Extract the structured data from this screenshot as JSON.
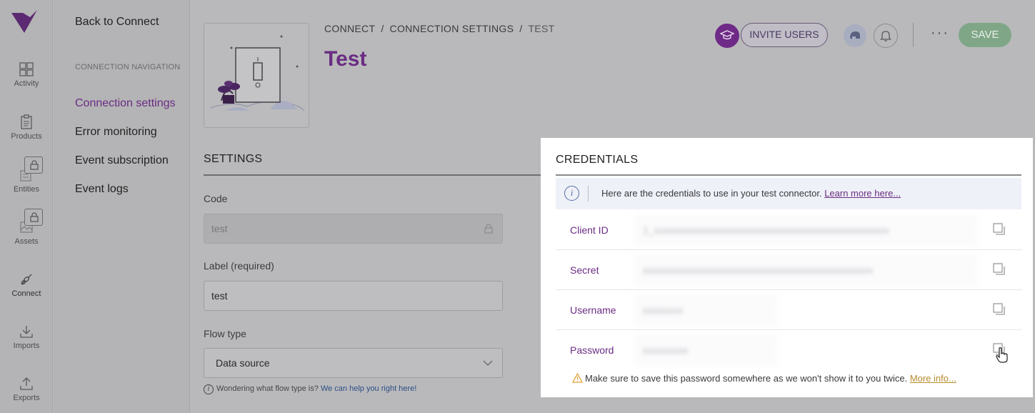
{
  "rail": {
    "items": [
      {
        "label": "Activity",
        "icon": "grid-icon"
      },
      {
        "label": "Products",
        "icon": "clipboard-icon"
      },
      {
        "label": "Entities",
        "icon": "entities-icon"
      },
      {
        "label": "Assets",
        "icon": "image-icon"
      },
      {
        "label": "Connect",
        "icon": "link-icon"
      },
      {
        "label": "Imports",
        "icon": "download-icon"
      },
      {
        "label": "Exports",
        "icon": "upload-icon"
      }
    ]
  },
  "subnav": {
    "back": "Back to Connect",
    "heading": "CONNECTION NAVIGATION",
    "items": [
      {
        "label": "Connection settings"
      },
      {
        "label": "Error monitoring"
      },
      {
        "label": "Event subscription"
      },
      {
        "label": "Event logs"
      }
    ]
  },
  "header": {
    "breadcrumb": [
      "CONNECT",
      "CONNECTION SETTINGS",
      "TEST"
    ],
    "title": "Test",
    "invite_label": "INVITE USERS",
    "more_label": "···",
    "save_label": "SAVE"
  },
  "settings": {
    "section_title": "SETTINGS",
    "code_label": "Code",
    "code_value": "test",
    "label_label": "Label (required)",
    "label_value": "test",
    "flow_label": "Flow type",
    "flow_value": "Data source",
    "hint_text": "Wondering what flow type is?",
    "hint_link": "We can help you right here!"
  },
  "credentials": {
    "title": "CREDENTIALS",
    "info_text": "Here are the credentials to use in your test connector.",
    "info_link": "Learn more here...",
    "rows": [
      {
        "label": "Client ID",
        "value": "1_xxxxxxxxxxxxxxxxxxxxxxxxxxxxxxxxxxxxxxxxxxxxxxx"
      },
      {
        "label": "Secret",
        "value": "xxxxxxxxxxxxxxxxxxxxxxxxxxxxxxxxxxxxxxxxxxxxxx"
      },
      {
        "label": "Username",
        "value": "xxxxxxxx"
      },
      {
        "label": "Password",
        "value": "xxxxxxxxx"
      }
    ],
    "warning_text": "Make sure to save this password somewhere as we won't show it to you twice.",
    "warning_link": "More info..."
  },
  "colors": {
    "brand_purple": "#6a2c82",
    "save_green": "#7fa787",
    "warning_amber": "#e3a43c"
  }
}
